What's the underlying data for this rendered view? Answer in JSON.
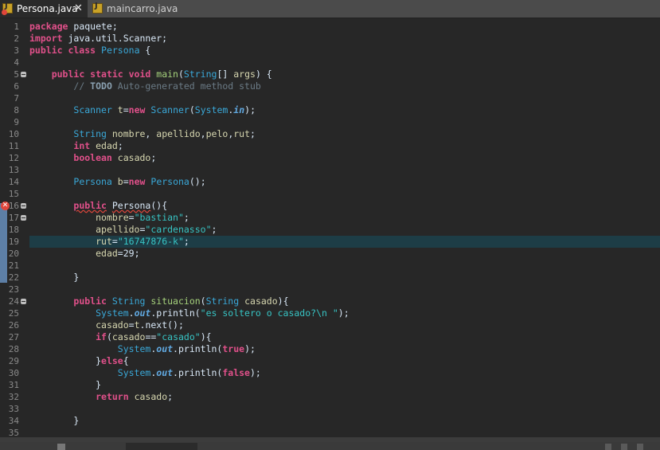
{
  "tabs": [
    {
      "label": "Persona.java",
      "active": true,
      "close": "✕"
    },
    {
      "label": "maincarro.java",
      "active": false
    }
  ],
  "error_marker": "✕",
  "current_line": 19,
  "lines": [
    {
      "n": "1",
      "t": [
        [
          "kw",
          "package"
        ],
        [
          "p",
          " paquete;"
        ]
      ]
    },
    {
      "n": "2",
      "t": [
        [
          "kw",
          "import"
        ],
        [
          "p",
          " java.util.Scanner;"
        ]
      ]
    },
    {
      "n": "3",
      "t": [
        [
          "kw",
          "public class"
        ],
        [
          "p",
          " "
        ],
        [
          "typ",
          "Persona"
        ],
        [
          "p",
          " {"
        ]
      ]
    },
    {
      "n": "4",
      "t": []
    },
    {
      "n": "5",
      "fold": true,
      "t": [
        [
          "p",
          "    "
        ],
        [
          "kw",
          "public static void"
        ],
        [
          "p",
          " "
        ],
        [
          "fn",
          "main"
        ],
        [
          "p",
          "("
        ],
        [
          "typ",
          "String"
        ],
        [
          "p",
          "[] "
        ],
        [
          "var",
          "args"
        ],
        [
          "p",
          ") {"
        ]
      ]
    },
    {
      "n": "6",
      "t": [
        [
          "p",
          "        "
        ],
        [
          "cm",
          "// "
        ],
        [
          "todo",
          "TODO"
        ],
        [
          "cm",
          " Auto-generated method stub"
        ]
      ]
    },
    {
      "n": "7",
      "t": []
    },
    {
      "n": "8",
      "t": [
        [
          "p",
          "        "
        ],
        [
          "typ",
          "Scanner"
        ],
        [
          "p",
          " "
        ],
        [
          "var",
          "t"
        ],
        [
          "p",
          "="
        ],
        [
          "kw",
          "new"
        ],
        [
          "p",
          " "
        ],
        [
          "typ",
          "Scanner"
        ],
        [
          "p",
          "("
        ],
        [
          "typ",
          "System"
        ],
        [
          "p",
          "."
        ],
        [
          "st",
          "in"
        ],
        [
          "p",
          ");"
        ]
      ]
    },
    {
      "n": "9",
      "t": []
    },
    {
      "n": "10",
      "t": [
        [
          "p",
          "        "
        ],
        [
          "typ",
          "String"
        ],
        [
          "p",
          " "
        ],
        [
          "var",
          "nombre"
        ],
        [
          "p",
          ", "
        ],
        [
          "var",
          "apellido"
        ],
        [
          "p",
          ","
        ],
        [
          "var",
          "pelo"
        ],
        [
          "p",
          ","
        ],
        [
          "var",
          "rut"
        ],
        [
          "p",
          ";"
        ]
      ]
    },
    {
      "n": "11",
      "t": [
        [
          "p",
          "        "
        ],
        [
          "kw",
          "int"
        ],
        [
          "p",
          " "
        ],
        [
          "var",
          "edad"
        ],
        [
          "p",
          ";"
        ]
      ]
    },
    {
      "n": "12",
      "t": [
        [
          "p",
          "        "
        ],
        [
          "kw",
          "boolean"
        ],
        [
          "p",
          " "
        ],
        [
          "var",
          "casado"
        ],
        [
          "p",
          ";"
        ]
      ]
    },
    {
      "n": "13",
      "t": []
    },
    {
      "n": "14",
      "t": [
        [
          "p",
          "        "
        ],
        [
          "typ",
          "Persona"
        ],
        [
          "p",
          " "
        ],
        [
          "var",
          "b"
        ],
        [
          "p",
          "="
        ],
        [
          "kw",
          "new"
        ],
        [
          "p",
          " "
        ],
        [
          "typ",
          "Persona"
        ],
        [
          "p",
          "();"
        ]
      ]
    },
    {
      "n": "15",
      "t": []
    },
    {
      "n": "16",
      "err": true,
      "fold": true,
      "t": [
        [
          "p",
          "        "
        ],
        [
          "kwerr",
          "public"
        ],
        [
          "p",
          " "
        ],
        [
          "fnerr",
          "Persona"
        ],
        [
          "p",
          "(){"
        ]
      ]
    },
    {
      "n": "17",
      "fold": true,
      "t": [
        [
          "p",
          "            "
        ],
        [
          "var",
          "nombre"
        ],
        [
          "p",
          "="
        ],
        [
          "str",
          "\"bastian\""
        ],
        [
          "p",
          ";"
        ]
      ]
    },
    {
      "n": "18",
      "t": [
        [
          "p",
          "            "
        ],
        [
          "var",
          "apellido"
        ],
        [
          "p",
          "="
        ],
        [
          "str",
          "\"cardenasso\""
        ],
        [
          "p",
          ";"
        ]
      ]
    },
    {
      "n": "19",
      "t": [
        [
          "p",
          "            "
        ],
        [
          "var",
          "rut"
        ],
        [
          "p",
          "="
        ],
        [
          "str",
          "\"16747876-k\""
        ],
        [
          "p",
          ";"
        ]
      ]
    },
    {
      "n": "20",
      "t": [
        [
          "p",
          "            "
        ],
        [
          "var",
          "edad"
        ],
        [
          "p",
          "=29;"
        ]
      ]
    },
    {
      "n": "21",
      "t": []
    },
    {
      "n": "22",
      "t": [
        [
          "p",
          "        }"
        ]
      ]
    },
    {
      "n": "23",
      "t": []
    },
    {
      "n": "24",
      "fold": true,
      "t": [
        [
          "p",
          "        "
        ],
        [
          "kw",
          "public"
        ],
        [
          "p",
          " "
        ],
        [
          "typ",
          "String"
        ],
        [
          "p",
          " "
        ],
        [
          "fn",
          "situacion"
        ],
        [
          "p",
          "("
        ],
        [
          "typ",
          "String"
        ],
        [
          "p",
          " "
        ],
        [
          "var",
          "casado"
        ],
        [
          "p",
          "){"
        ]
      ]
    },
    {
      "n": "25",
      "t": [
        [
          "p",
          "            "
        ],
        [
          "typ",
          "System"
        ],
        [
          "p",
          "."
        ],
        [
          "st",
          "out"
        ],
        [
          "p",
          ".println("
        ],
        [
          "str",
          "\"es soltero o casado?\\n \""
        ],
        [
          "p",
          ");"
        ]
      ]
    },
    {
      "n": "26",
      "t": [
        [
          "p",
          "            "
        ],
        [
          "var",
          "casado"
        ],
        [
          "p",
          "="
        ],
        [
          "var",
          "t"
        ],
        [
          "p",
          ".next();"
        ]
      ]
    },
    {
      "n": "27",
      "t": [
        [
          "p",
          "            "
        ],
        [
          "kw",
          "if"
        ],
        [
          "p",
          "("
        ],
        [
          "var",
          "casado"
        ],
        [
          "p",
          "=="
        ],
        [
          "str",
          "\"casado\""
        ],
        [
          "p",
          "){"
        ]
      ]
    },
    {
      "n": "28",
      "t": [
        [
          "p",
          "                "
        ],
        [
          "typ",
          "System"
        ],
        [
          "p",
          "."
        ],
        [
          "st",
          "out"
        ],
        [
          "p",
          ".println("
        ],
        [
          "kw",
          "true"
        ],
        [
          "p",
          ");"
        ]
      ]
    },
    {
      "n": "29",
      "t": [
        [
          "p",
          "            }"
        ],
        [
          "kw",
          "else"
        ],
        [
          "p",
          "{"
        ]
      ]
    },
    {
      "n": "30",
      "t": [
        [
          "p",
          "                "
        ],
        [
          "typ",
          "System"
        ],
        [
          "p",
          "."
        ],
        [
          "st",
          "out"
        ],
        [
          "p",
          ".println("
        ],
        [
          "kw",
          "false"
        ],
        [
          "p",
          ");"
        ]
      ]
    },
    {
      "n": "31",
      "t": [
        [
          "p",
          "            }"
        ]
      ]
    },
    {
      "n": "32",
      "t": [
        [
          "p",
          "            "
        ],
        [
          "kw",
          "return"
        ],
        [
          "p",
          " "
        ],
        [
          "var",
          "casado"
        ],
        [
          "p",
          ";"
        ]
      ]
    },
    {
      "n": "33",
      "t": []
    },
    {
      "n": "34",
      "t": [
        [
          "p",
          "        }"
        ]
      ]
    },
    {
      "n": "35",
      "t": []
    }
  ]
}
